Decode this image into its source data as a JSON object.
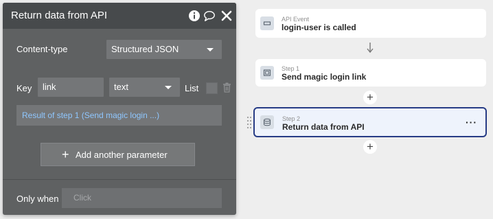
{
  "editor": {
    "title": "Return data from API",
    "content_type_label": "Content-type",
    "content_type_value": "Structured JSON",
    "key_label": "Key",
    "key_value": "link",
    "type_value": "text",
    "list_label": "List",
    "expression": "Result of step 1 (Send magic login ...)",
    "add_param_label": "Add another parameter",
    "only_when_label": "Only when",
    "only_when_placeholder": "Click"
  },
  "workflow": {
    "event": {
      "subtitle": "API Event",
      "title": "login-user is called"
    },
    "steps": [
      {
        "subtitle": "Step 1",
        "title": "Send magic login link"
      },
      {
        "subtitle": "Step 2",
        "title": "Return data from API"
      }
    ],
    "more_label": "···",
    "add_symbol": "+",
    "accent_color": "#263b85"
  }
}
